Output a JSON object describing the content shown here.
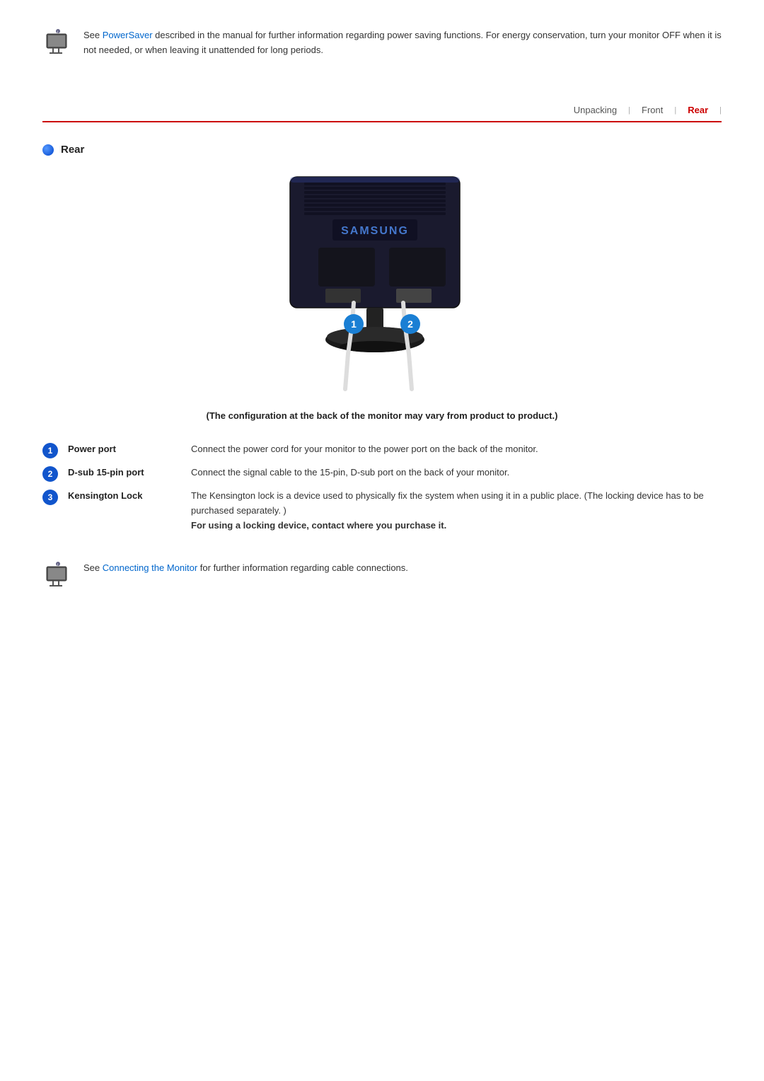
{
  "top_note": {
    "text_before_link": "See ",
    "link_text": "PowerSaver",
    "text_after_link": " described in the manual for further information regarding power saving functions. For energy conservation, turn your monitor OFF when it is not needed, or when leaving it unattended for long periods."
  },
  "nav": {
    "tabs": [
      {
        "label": "Unpacking",
        "active": false
      },
      {
        "label": "Front",
        "active": false
      },
      {
        "label": "Rear",
        "active": true
      }
    ],
    "separator": "|"
  },
  "section": {
    "heading": "Rear"
  },
  "caption": "(The configuration at the back of the monitor may vary from product to product.)",
  "components": [
    {
      "number": "1",
      "name": "Power port",
      "description": "Connect the power cord for your monitor to the power port on the back of the monitor."
    },
    {
      "number": "2",
      "name": "D-sub 15-pin port",
      "description": "Connect the signal cable to the 15-pin, D-sub port on the back of your monitor."
    },
    {
      "number": "3",
      "name": "Kensington Lock",
      "description": "The Kensington lock is a device used to physically fix the system when using it in a public place. (The locking device has to be purchased separately. )",
      "description_bold": "For using a locking device, contact where you purchase it."
    }
  ],
  "bottom_note": {
    "text_before_link": "See ",
    "link_text": "Connecting the Monitor",
    "text_after_link": " for further information regarding cable connections."
  }
}
